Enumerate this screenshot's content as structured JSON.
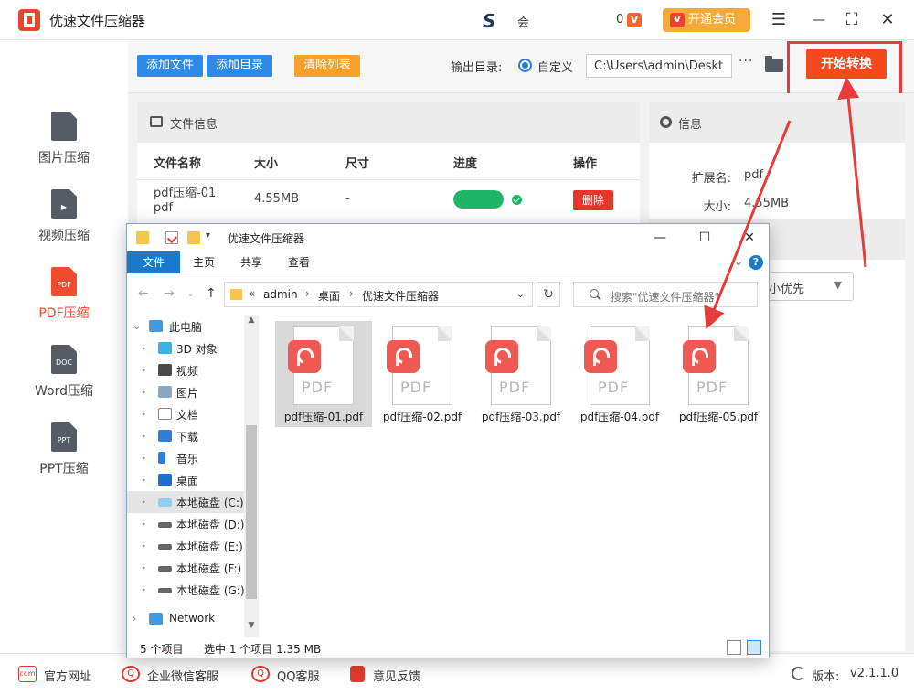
{
  "app": {
    "title": "优速文件压缩器",
    "user_logo": "S",
    "user_name": "会",
    "coins": "0",
    "coin_icon": "V",
    "vip_label": "开通会员",
    "vip_icon": "V"
  },
  "window_controls": {
    "menu": "☰",
    "minimize": "—",
    "maximize": "⛶",
    "close": "✕"
  },
  "sidebar": [
    {
      "label": "图片压缩",
      "icon": "image-doc-icon",
      "badge": "",
      "active": false
    },
    {
      "label": "视频压缩",
      "icon": "video-doc-icon",
      "badge": "▶",
      "active": false
    },
    {
      "label": "PDF压缩",
      "icon": "pdf-doc-icon",
      "badge": "PDF",
      "active": true
    },
    {
      "label": "Word压缩",
      "icon": "doc-icon",
      "badge": "DOC",
      "active": false
    },
    {
      "label": "PPT压缩",
      "icon": "ppt-icon",
      "badge": "PPT",
      "active": false
    }
  ],
  "toolbar": {
    "add_file": "添加文件",
    "add_dir": "添加目录",
    "clear_list": "清除列表",
    "output_label": "输出目录:",
    "custom_label": "自定义",
    "output_path": "C:\\Users\\admin\\Desktop",
    "more": "···",
    "start": "开始转换",
    "colors": {
      "blue": "#2e8ae6",
      "orange": "#f7a12a",
      "start": "#f24a1e"
    }
  },
  "file_panel": {
    "title": "文件信息",
    "headers": [
      "文件名称",
      "大小",
      "尺寸",
      "进度",
      "操作"
    ],
    "rows": [
      {
        "name_line1": "pdf压缩-01.",
        "name_line2": "pdf",
        "size": "4.55MB",
        "dimension": "-",
        "progress": 1.0,
        "action": "删除"
      }
    ]
  },
  "info_panel": {
    "title": "信息",
    "ext_label": "扩展名:",
    "ext_value": "pdf",
    "size_label": "大小:",
    "size_value": "4.55MB",
    "priority_value": "小优先"
  },
  "explorer": {
    "title": "优速文件压缩器",
    "tabs": [
      "文件",
      "主页",
      "共享",
      "查看"
    ],
    "help": "?",
    "breadcrumb": [
      "admin",
      "桌面",
      "优速文件压缩器"
    ],
    "breadcrumb_prefix": "«",
    "search_placeholder": "搜索\"优速文件压缩器\"",
    "nav": [
      {
        "label": "此电脑",
        "icon": "computer-icon",
        "level": 0,
        "expanded": true
      },
      {
        "label": "3D 对象",
        "icon": "3d-objects-icon",
        "level": 1
      },
      {
        "label": "视频",
        "icon": "video-folder-icon",
        "level": 1
      },
      {
        "label": "图片",
        "icon": "pictures-folder-icon",
        "level": 1
      },
      {
        "label": "文档",
        "icon": "documents-folder-icon",
        "level": 1
      },
      {
        "label": "下载",
        "icon": "download-icon",
        "level": 1
      },
      {
        "label": "音乐",
        "icon": "music-icon",
        "level": 1
      },
      {
        "label": "桌面",
        "icon": "desktop-icon",
        "level": 1
      },
      {
        "label": "本地磁盘 (C:)",
        "icon": "drive-c-icon",
        "level": 1,
        "selected": true
      },
      {
        "label": "本地磁盘 (D:)",
        "icon": "drive-icon",
        "level": 1
      },
      {
        "label": "本地磁盘 (E:)",
        "icon": "drive-icon",
        "level": 1
      },
      {
        "label": "本地磁盘 (F:)",
        "icon": "drive-icon",
        "level": 1
      },
      {
        "label": "本地磁盘 (G:)",
        "icon": "drive-icon",
        "level": 1
      },
      {
        "label": "Network",
        "icon": "network-icon",
        "level": 0
      }
    ],
    "files": [
      {
        "name": "pdf压缩-01.pdf",
        "selected": true
      },
      {
        "name": "pdf压缩-02.pdf",
        "selected": false
      },
      {
        "name": "pdf压缩-03.pdf",
        "selected": false
      },
      {
        "name": "pdf压缩-04.pdf",
        "selected": false
      },
      {
        "name": "pdf压缩-05.pdf",
        "selected": false
      }
    ],
    "file_icon_text": "PDF",
    "status_count": "5 个项目",
    "status_selected": "选中 1 个项目  1.35 MB"
  },
  "footer": {
    "website": "官方网址",
    "wechat": "企业微信客服",
    "qq": "QQ客服",
    "feedback": "意见反馈",
    "version_label": "版本:",
    "version_value": "v2.1.1.0",
    "website_icon_text": "com",
    "wechat_icon_text": "Q",
    "qq_icon_text": "Q"
  }
}
